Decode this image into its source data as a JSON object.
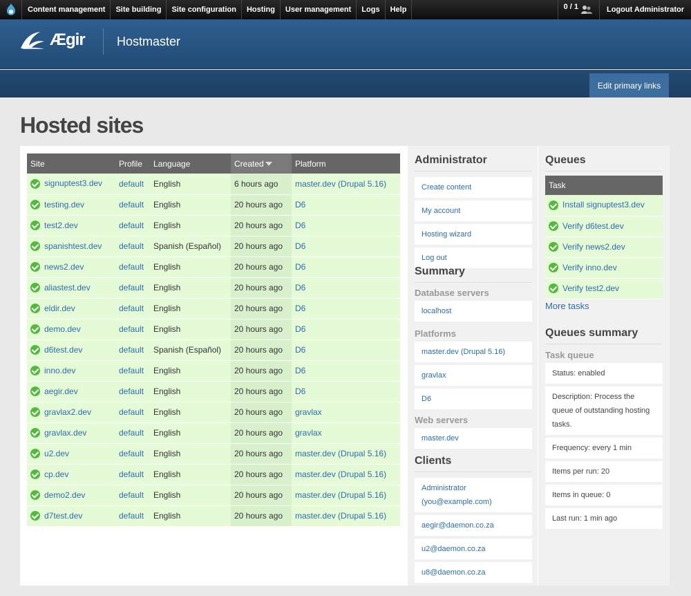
{
  "toolbar": {
    "menu": [
      "Content management",
      "Site building",
      "Site configuration",
      "Hosting",
      "User management",
      "Logs",
      "Help"
    ],
    "users_count": "0 / 1",
    "logout": "Logout Administrator"
  },
  "header": {
    "logo_text": "Ægir",
    "site_name": "Hostmaster",
    "edit_primary_links": "Edit primary links"
  },
  "page_title": "Hosted sites",
  "sites_table": {
    "headers": [
      "Site",
      "Profile",
      "Language",
      "Created",
      "Platform"
    ],
    "rows": [
      [
        "signuptest3.dev",
        "default",
        "English",
        "6 hours ago",
        "master.dev (Drupal 5.16)"
      ],
      [
        "testing.dev",
        "default",
        "English",
        "20 hours ago",
        "D6"
      ],
      [
        "test2.dev",
        "default",
        "English",
        "20 hours ago",
        "D6"
      ],
      [
        "spanishtest.dev",
        "default",
        "Spanish (Español)",
        "20 hours ago",
        "D6"
      ],
      [
        "news2.dev",
        "default",
        "English",
        "20 hours ago",
        "D6"
      ],
      [
        "aliastest.dev",
        "default",
        "English",
        "20 hours ago",
        "D6"
      ],
      [
        "eldir.dev",
        "default",
        "English",
        "20 hours ago",
        "D6"
      ],
      [
        "demo.dev",
        "default",
        "English",
        "20 hours ago",
        "D6"
      ],
      [
        "d6test.dev",
        "default",
        "Spanish (Español)",
        "20 hours ago",
        "D6"
      ],
      [
        "inno.dev",
        "default",
        "English",
        "20 hours ago",
        "D6"
      ],
      [
        "aegir.dev",
        "default",
        "English",
        "20 hours ago",
        "D6"
      ],
      [
        "gravlax2.dev",
        "default",
        "English",
        "20 hours ago",
        "gravlax"
      ],
      [
        "gravlax.dev",
        "default",
        "English",
        "20 hours ago",
        "gravlax"
      ],
      [
        "u2.dev",
        "default",
        "English",
        "20 hours ago",
        "master.dev (Drupal 5.16)"
      ],
      [
        "cp.dev",
        "default",
        "English",
        "20 hours ago",
        "master.dev (Drupal 5.16)"
      ],
      [
        "demo2.dev",
        "default",
        "English",
        "20 hours ago",
        "master.dev (Drupal 5.16)"
      ],
      [
        "d7test.dev",
        "default",
        "English",
        "20 hours ago",
        "master.dev (Drupal 5.16)"
      ]
    ]
  },
  "administrator": {
    "title": "Administrator",
    "links": [
      "Create content",
      "My account",
      "Hosting wizard",
      "Log out"
    ]
  },
  "summary": {
    "title": "Summary",
    "database_servers_title": "Database servers",
    "database_servers": [
      "localhost"
    ],
    "platforms_title": "Platforms",
    "platforms": [
      "master.dev (Drupal 5.16)",
      "gravlax",
      "D6"
    ],
    "web_servers_title": "Web servers",
    "web_servers": [
      "master.dev"
    ]
  },
  "clients": {
    "title": "Clients",
    "items": [
      "Administrator (you@example.com)",
      "aegir@daemon.co.za",
      "u2@daemon.co.za",
      "u8@daemon.co.za"
    ]
  },
  "queues": {
    "title": "Queues",
    "header": "Task",
    "tasks": [
      "Install signuptest3.dev",
      "Verify d6test.dev",
      "Verify news2.dev",
      "Verify inno.dev",
      "Verify test2.dev"
    ],
    "more": "More tasks"
  },
  "queues_summary": {
    "title": "Queues summary",
    "subtitle": "Task queue",
    "items": [
      "Status: enabled",
      "Description: Process the queue of outstanding hosting tasks.",
      "Frequency: every 1 min",
      "Items per run: 20",
      "Items in queue: 0",
      "Last run: 1 min ago"
    ]
  }
}
